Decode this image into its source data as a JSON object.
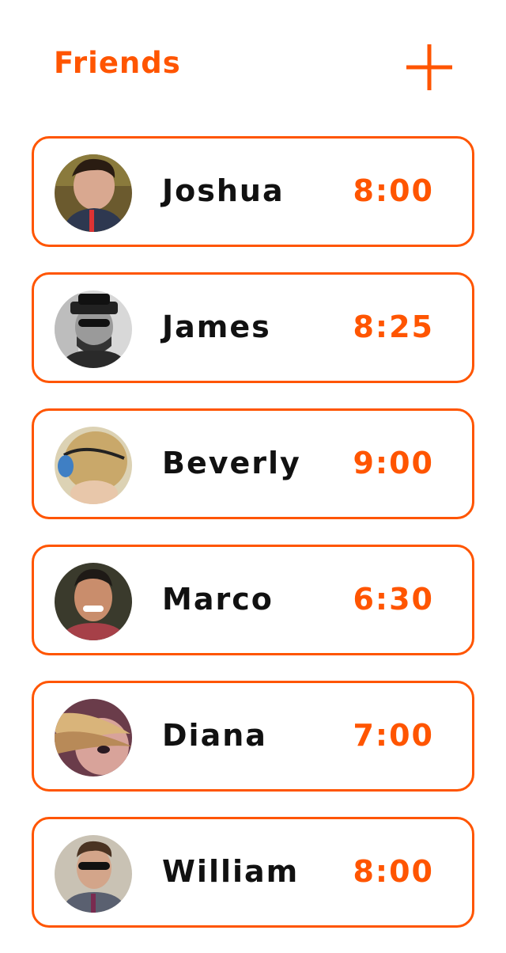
{
  "header": {
    "title": "Friends",
    "add_icon": "plus-icon",
    "accent_color": "#ff5500"
  },
  "friends": [
    {
      "name": "Joshua",
      "time": "8:00",
      "avatar_icon": "avatar-photo"
    },
    {
      "name": "James",
      "time": "8:25",
      "avatar_icon": "avatar-photo"
    },
    {
      "name": "Beverly",
      "time": "9:00",
      "avatar_icon": "avatar-photo"
    },
    {
      "name": "Marco",
      "time": "6:30",
      "avatar_icon": "avatar-photo"
    },
    {
      "name": "Diana",
      "time": "7:00",
      "avatar_icon": "avatar-photo"
    },
    {
      "name": "William",
      "time": "8:00",
      "avatar_icon": "avatar-photo"
    }
  ]
}
